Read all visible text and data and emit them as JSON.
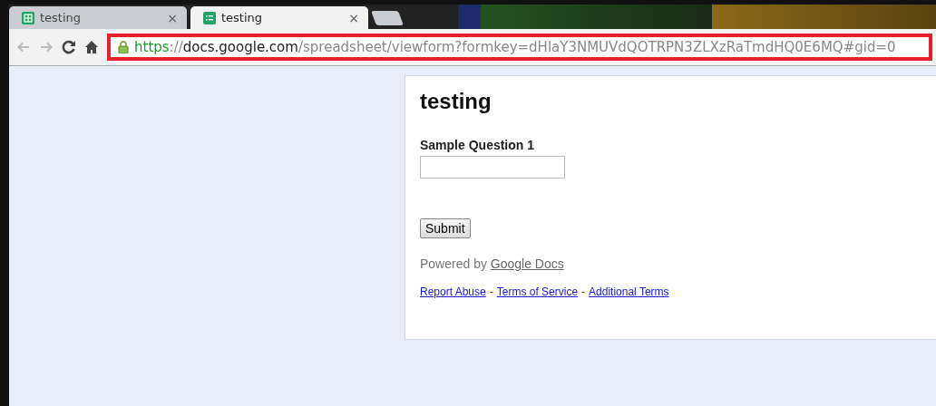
{
  "tabs": [
    {
      "title": "testing",
      "kind": "spreadsheet",
      "selected": false
    },
    {
      "title": "testing",
      "kind": "form",
      "selected": true
    }
  ],
  "close_glyph": "×",
  "toolbar": {
    "back_disabled": true,
    "forward_disabled": true
  },
  "address_bar": {
    "secure": true,
    "highlighted": true,
    "url": [
      {
        "text": "https",
        "kind": "scheme"
      },
      {
        "text": "://",
        "kind": "plain"
      },
      {
        "text": "docs.google.com",
        "kind": "host"
      },
      {
        "text": "/spreadsheet/viewform?formkey=dHlaY3NMUVdQOTRPN3ZLXzRaTmdHQ0E6MQ#gid=0",
        "kind": "plain"
      }
    ]
  },
  "form": {
    "title": "testing",
    "questions": [
      {
        "label": "Sample Question 1"
      }
    ],
    "submit": "Submit",
    "powered_by": "Powered by",
    "powered_link": "Google Docs",
    "footer_links": [
      "Report Abuse",
      "Terms of Service",
      "Additional Terms"
    ],
    "separator": "-"
  }
}
